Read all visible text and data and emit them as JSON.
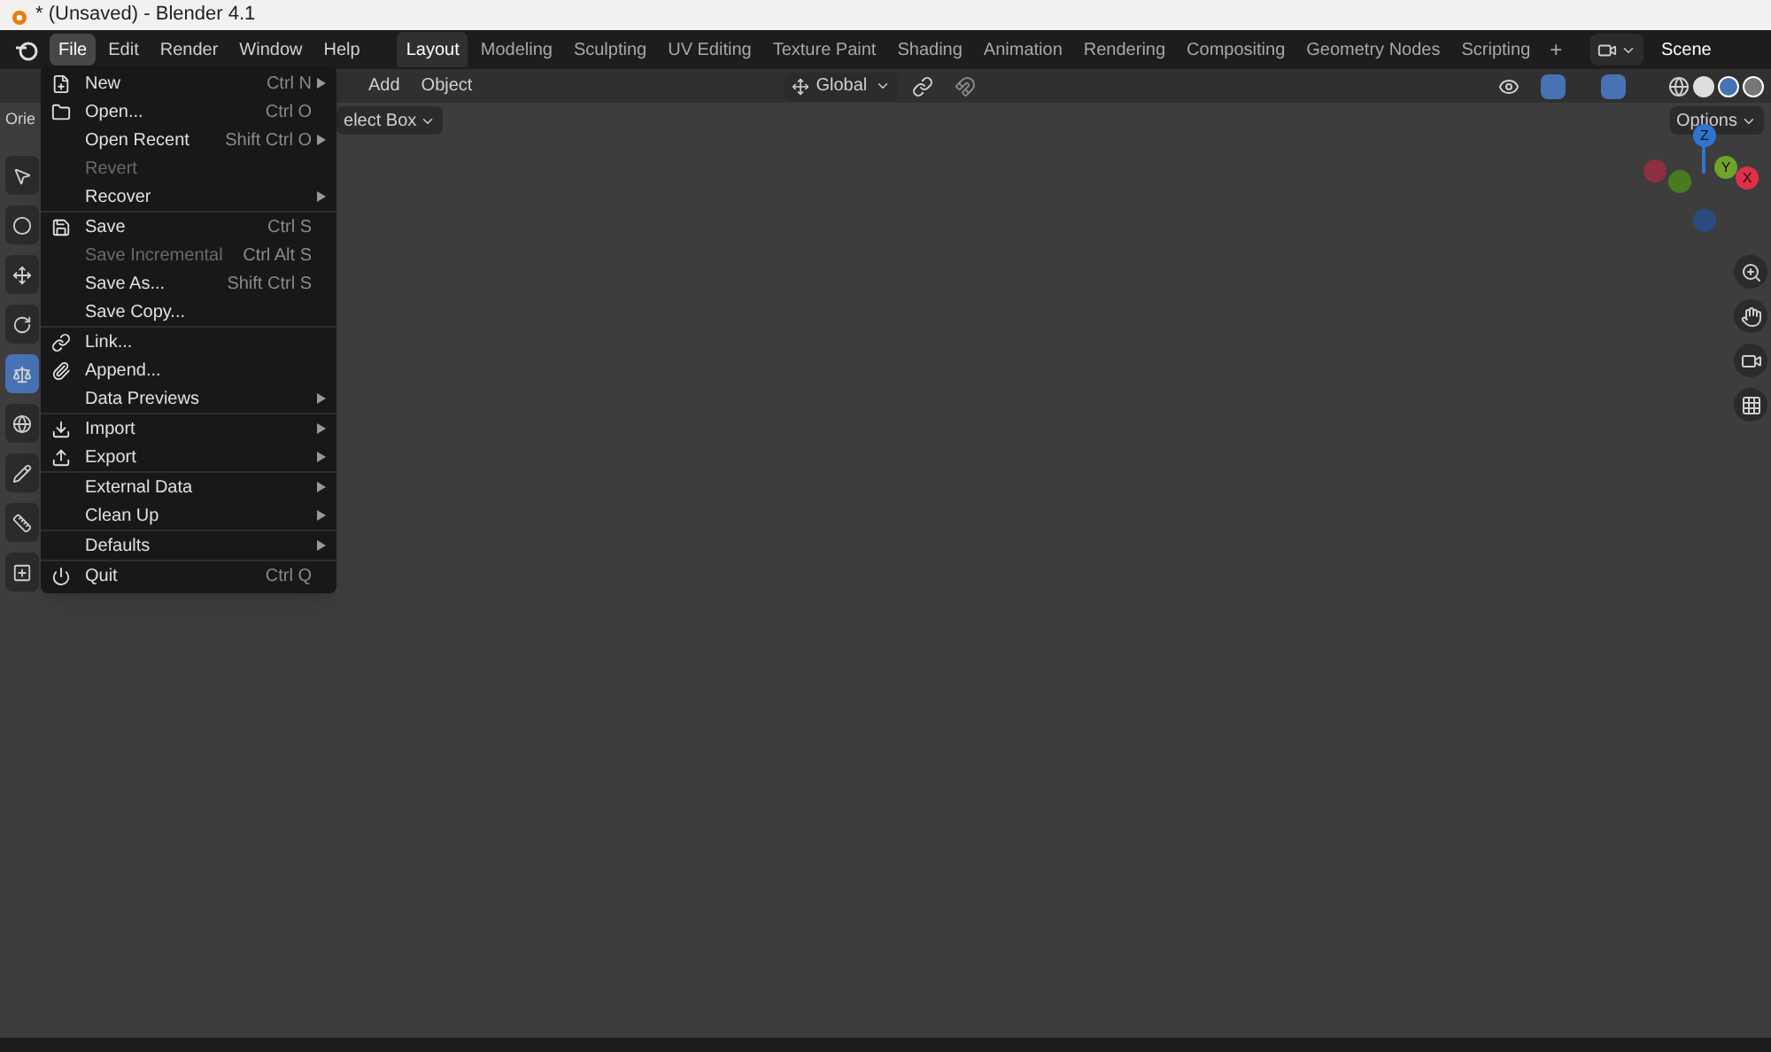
{
  "window": {
    "title": "* (Unsaved) - Blender 4.1"
  },
  "menus": [
    {
      "label": "File",
      "selected": true
    },
    {
      "label": "Edit",
      "selected": false
    },
    {
      "label": "Render",
      "selected": false
    },
    {
      "label": "Window",
      "selected": false
    },
    {
      "label": "Help",
      "selected": false
    }
  ],
  "workspaces": [
    {
      "label": "Layout",
      "selected": true
    },
    {
      "label": "Modeling",
      "selected": false
    },
    {
      "label": "Sculpting",
      "selected": false
    },
    {
      "label": "UV Editing",
      "selected": false
    },
    {
      "label": "Texture Paint",
      "selected": false
    },
    {
      "label": "Shading",
      "selected": false
    },
    {
      "label": "Animation",
      "selected": false
    },
    {
      "label": "Rendering",
      "selected": false
    },
    {
      "label": "Compositing",
      "selected": false
    },
    {
      "label": "Geometry Nodes",
      "selected": false
    },
    {
      "label": "Scripting",
      "selected": false
    }
  ],
  "add_workspace": "+",
  "scene": "Scene",
  "header": {
    "mode_menus": [
      "Add",
      "Object"
    ],
    "orientation": "Global",
    "tool_label": "Orie",
    "select_mode": "elect Box",
    "options": "Options"
  },
  "tools": [
    {
      "selected": false
    },
    {
      "selected": false
    },
    {
      "selected": false
    },
    {
      "selected": false
    },
    {
      "selected": true
    },
    {
      "selected": false
    },
    {
      "selected": false
    },
    {
      "selected": false
    },
    {
      "selected": false
    }
  ],
  "gizmo": {
    "axes": [
      "Z",
      "Y",
      "X"
    ]
  },
  "file_menu": {
    "groups": [
      [
        {
          "label": "New",
          "shortcut": "Ctrl N",
          "submenu": true,
          "disabled": false
        },
        {
          "label": "Open...",
          "shortcut": "Ctrl O",
          "submenu": false,
          "disabled": false
        },
        {
          "label": "Open Recent",
          "shortcut": "Shift Ctrl O",
          "submenu": true,
          "disabled": false
        },
        {
          "label": "Revert",
          "submenu": false,
          "disabled": true
        },
        {
          "label": "Recover",
          "submenu": true,
          "disabled": false
        }
      ],
      [
        {
          "label": "Save",
          "shortcut": "Ctrl S",
          "submenu": false,
          "disabled": false
        },
        {
          "label": "Save Incremental",
          "shortcut": "Ctrl Alt S",
          "submenu": false,
          "disabled": true
        },
        {
          "label": "Save As...",
          "shortcut": "Shift Ctrl S",
          "submenu": false,
          "disabled": false
        },
        {
          "label": "Save Copy...",
          "submenu": false,
          "disabled": false
        }
      ],
      [
        {
          "label": "Link...",
          "submenu": false,
          "disabled": false
        },
        {
          "label": "Append...",
          "submenu": false,
          "disabled": false
        },
        {
          "label": "Data Previews",
          "submenu": true,
          "disabled": false
        }
      ],
      [
        {
          "label": "Import",
          "submenu": true,
          "disabled": false
        },
        {
          "label": "Export",
          "submenu": true,
          "disabled": false
        }
      ],
      [
        {
          "label": "External Data",
          "submenu": true,
          "disabled": false
        },
        {
          "label": "Clean Up",
          "submenu": true,
          "disabled": false
        }
      ],
      [
        {
          "label": "Defaults",
          "submenu": true,
          "disabled": false
        }
      ],
      [
        {
          "label": "Quit",
          "shortcut": "Ctrl Q",
          "submenu": false,
          "disabled": false
        }
      ]
    ]
  }
}
